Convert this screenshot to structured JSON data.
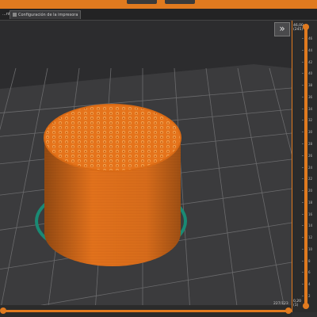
{
  "tabs": [
    {
      "label": "...nta"
    },
    {
      "label": "Configuración de la impresora"
    }
  ],
  "collapse_icon": "double-chevron-right-icon",
  "vertical_slider": {
    "top_value": "46,00",
    "top_layer": "(245)",
    "bottom_value": "0,20",
    "bottom_layer": "(1)",
    "ticks": [
      "46",
      "44",
      "42",
      "40",
      "38",
      "36",
      "34",
      "32",
      "30",
      "28",
      "26",
      "24",
      "22",
      "20",
      "18",
      "16",
      "14",
      "12",
      "10",
      "8",
      "6",
      "4",
      "2"
    ]
  },
  "horizontal_slider": {
    "label": "227/123"
  },
  "colors": {
    "accent": "#e07a1f",
    "model": "#e8781f",
    "bed_grid": "#6b6b6d",
    "skirt": "#1a8a74"
  }
}
